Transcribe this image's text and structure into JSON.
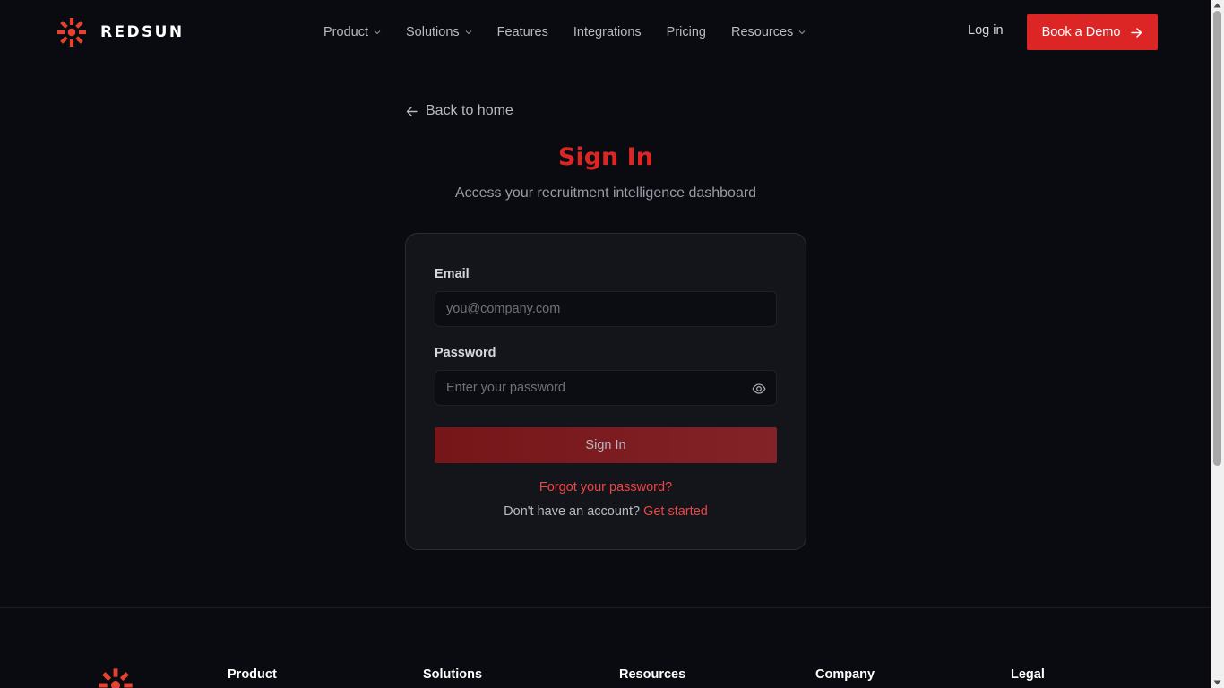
{
  "brand": {
    "name": "REDSUN",
    "accent": "#dc2626"
  },
  "nav": {
    "items": [
      {
        "label": "Product",
        "dropdown": true
      },
      {
        "label": "Solutions",
        "dropdown": true
      },
      {
        "label": "Features",
        "dropdown": false
      },
      {
        "label": "Integrations",
        "dropdown": false
      },
      {
        "label": "Pricing",
        "dropdown": false
      },
      {
        "label": "Resources",
        "dropdown": true
      }
    ],
    "login": "Log in",
    "demo": "Book a Demo"
  },
  "main": {
    "back": "Back to home",
    "title": "Sign In",
    "subtitle": "Access your recruitment intelligence dashboard",
    "form": {
      "email_label": "Email",
      "email_placeholder": "you@company.com",
      "password_label": "Password",
      "password_placeholder": "Enter your password",
      "submit": "Sign In",
      "forgot": "Forgot your password?",
      "no_account": "Don't have an account?",
      "get_started": "Get started"
    }
  },
  "footer": {
    "columns": [
      "Product",
      "Solutions",
      "Resources",
      "Company",
      "Legal"
    ]
  },
  "icons": {
    "logo": "sun-logo-icon",
    "chevron": "chevron-down-icon",
    "arrow_right": "arrow-right-icon",
    "arrow_left": "arrow-left-icon",
    "eye": "eye-icon"
  }
}
